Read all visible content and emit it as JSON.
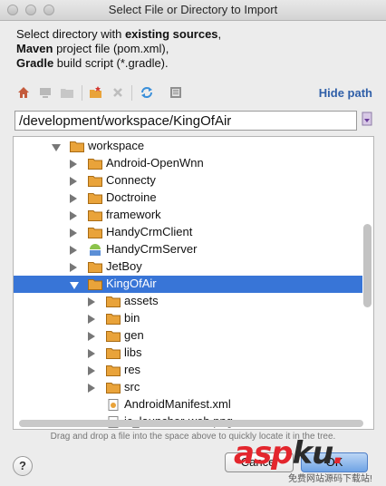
{
  "window": {
    "title": "Select File or Directory to Import"
  },
  "intro": {
    "l1_pre": "Select directory with ",
    "l1_bold": "existing sources",
    "l2_bold": "Maven",
    "l2_rest": " project file (pom.xml),",
    "l3_bold": "Gradle",
    "l3_rest": " build script (*.gradle)."
  },
  "toolbar": {
    "icons": [
      "home-icon",
      "desktop-icon",
      "folder-up-icon",
      "new-folder-icon",
      "delete-icon",
      "refresh-icon",
      "hidden-files-icon"
    ],
    "hide_path": "Hide path"
  },
  "path": {
    "value": "/development/workspace/KingOfAir"
  },
  "tree": [
    {
      "label": "workspace",
      "expanded": true,
      "depth": 0,
      "icon": "folder"
    },
    {
      "label": "Android-OpenWnn",
      "expanded": false,
      "depth": 1,
      "icon": "folder"
    },
    {
      "label": "Connecty",
      "expanded": false,
      "depth": 1,
      "icon": "folder"
    },
    {
      "label": "Doctroine",
      "expanded": false,
      "depth": 1,
      "icon": "folder"
    },
    {
      "label": "framework",
      "expanded": false,
      "depth": 1,
      "icon": "folder"
    },
    {
      "label": "HandyCrmClient",
      "expanded": false,
      "depth": 1,
      "icon": "folder"
    },
    {
      "label": "HandyCrmServer",
      "expanded": false,
      "depth": 1,
      "icon": "android"
    },
    {
      "label": "JetBoy",
      "expanded": false,
      "depth": 1,
      "icon": "folder"
    },
    {
      "label": "KingOfAir",
      "expanded": true,
      "depth": 1,
      "icon": "folder",
      "selected": true
    },
    {
      "label": "assets",
      "expanded": false,
      "depth": 2,
      "icon": "folder"
    },
    {
      "label": "bin",
      "expanded": false,
      "depth": 2,
      "icon": "folder"
    },
    {
      "label": "gen",
      "expanded": false,
      "depth": 2,
      "icon": "folder"
    },
    {
      "label": "libs",
      "expanded": false,
      "depth": 2,
      "icon": "folder"
    },
    {
      "label": "res",
      "expanded": false,
      "depth": 2,
      "icon": "folder"
    },
    {
      "label": "src",
      "expanded": false,
      "depth": 2,
      "icon": "folder"
    },
    {
      "label": "AndroidManifest.xml",
      "depth": 2,
      "icon": "xml-file"
    },
    {
      "label": "ic_launcher-web.png",
      "depth": 2,
      "icon": "image-file"
    }
  ],
  "hint": "Drag and drop a file into the space above to quickly locate it in the tree.",
  "buttons": {
    "help": "?",
    "cancel": "Cancel",
    "ok": "OK"
  },
  "watermark": {
    "asp": "asp",
    "ku": "ku",
    "dot": ".",
    "sub": "免费网站源码下载站!"
  },
  "colors": {
    "selection": "#3875d7",
    "folder": "#e9a33a",
    "link": "#2f5fa8"
  }
}
